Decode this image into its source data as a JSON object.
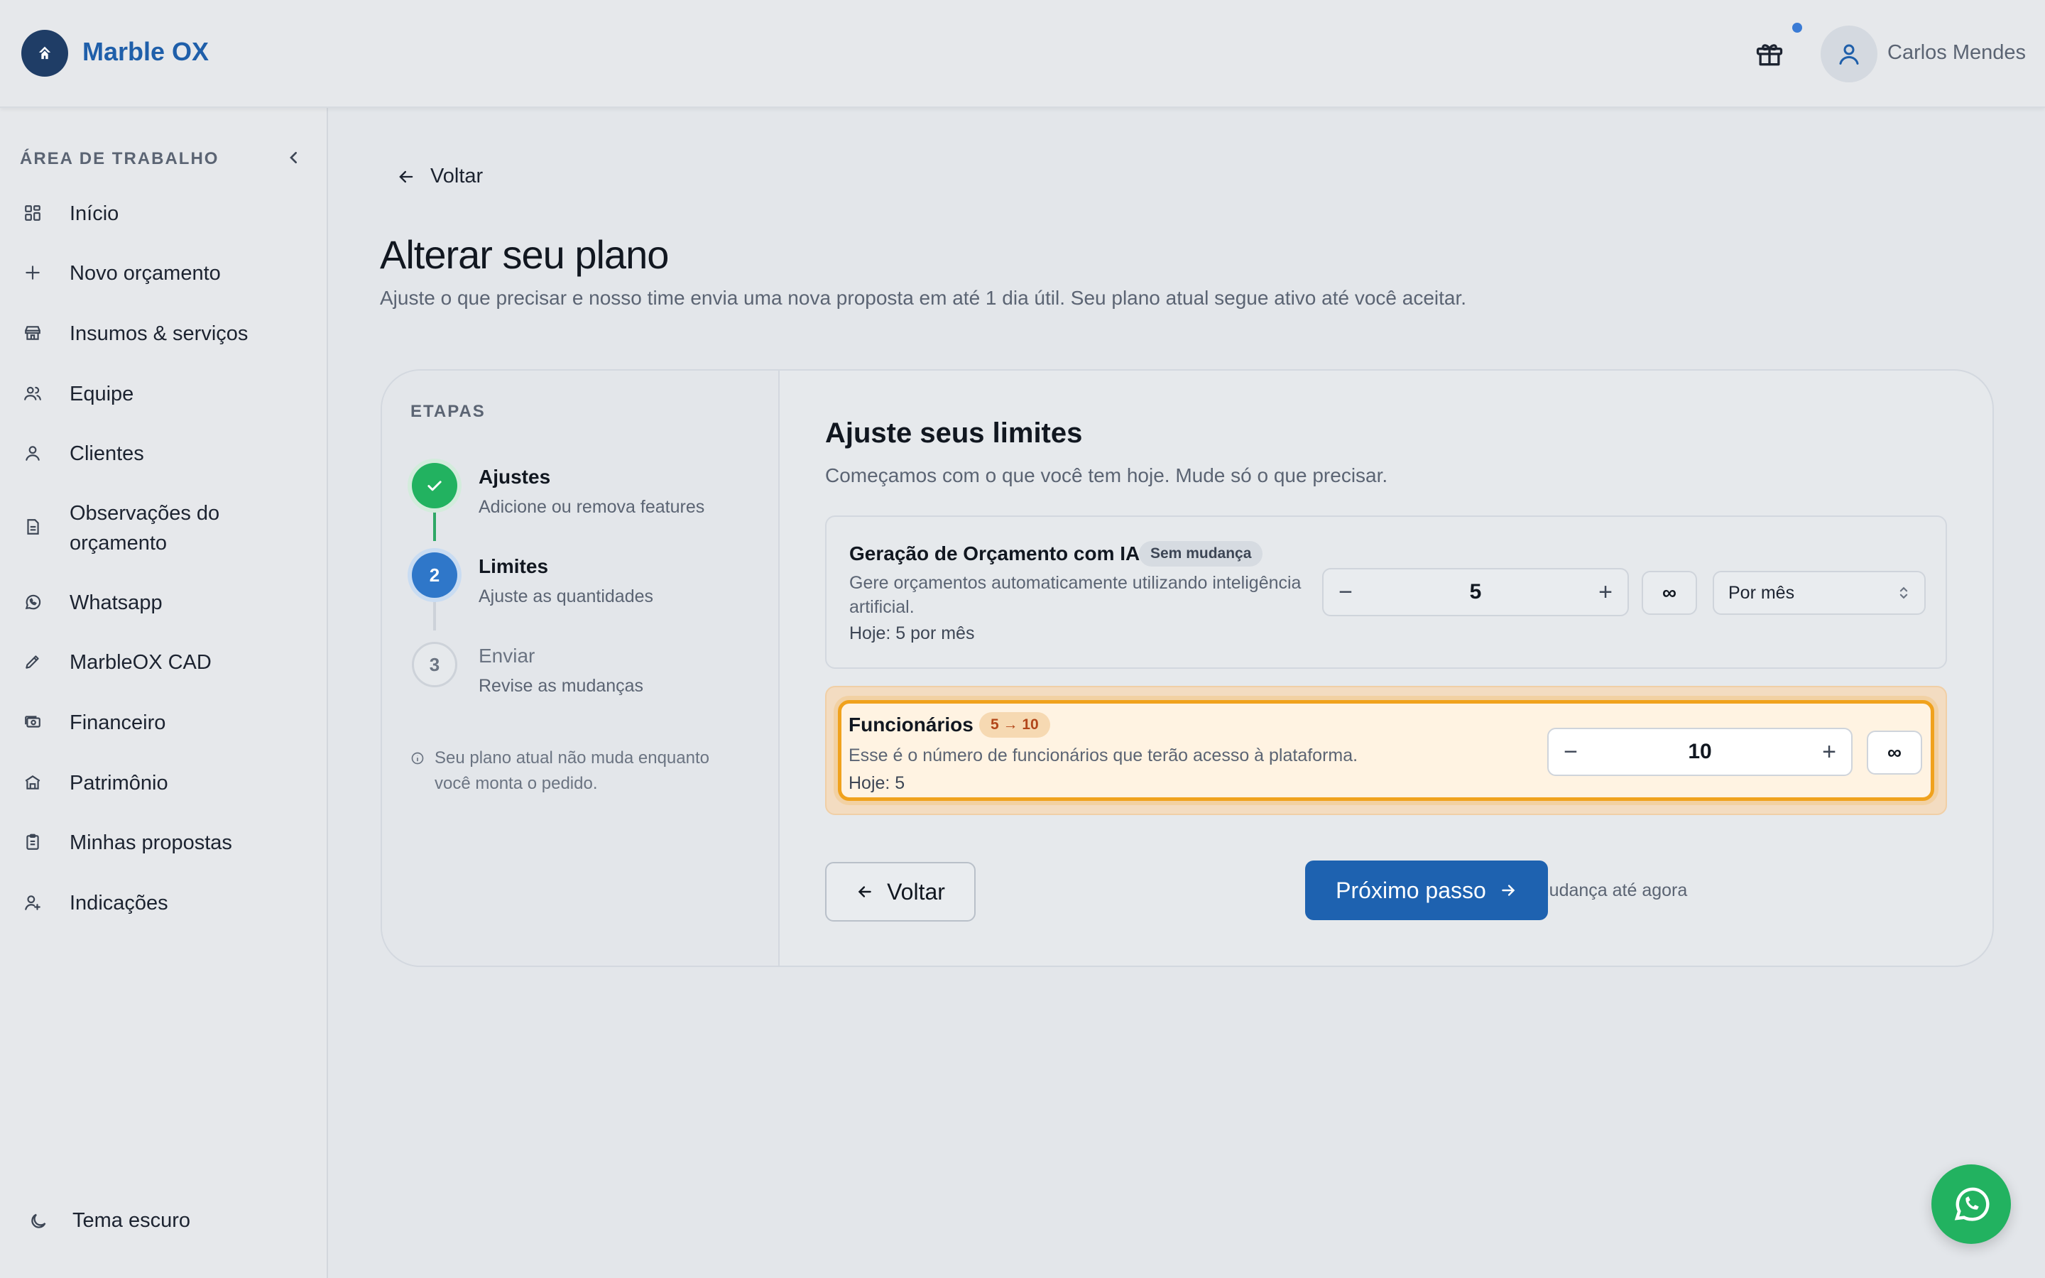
{
  "app": {
    "brand": "Marble OX"
  },
  "header": {
    "user_name": "Carlos Mendes"
  },
  "sidebar": {
    "section_title": "ÁREA DE TRABALHO",
    "items": [
      {
        "label": "Início",
        "icon": "grid-icon"
      },
      {
        "label": "Novo orçamento",
        "icon": "plus-icon"
      },
      {
        "label": "Insumos & serviços",
        "icon": "store-icon"
      },
      {
        "label": "Equipe",
        "icon": "users-icon"
      },
      {
        "label": "Clientes",
        "icon": "user-icon"
      },
      {
        "label": "Observações do",
        "label2": "orçamento",
        "icon": "document-icon"
      },
      {
        "label": "Whatsapp",
        "icon": "whatsapp-icon"
      },
      {
        "label": "MarbleOX CAD",
        "icon": "pencil-icon"
      },
      {
        "label": "Financeiro",
        "icon": "money-icon"
      },
      {
        "label": "Patrimônio",
        "icon": "building-icon"
      },
      {
        "label": "Minhas propostas",
        "icon": "clipboard-icon"
      },
      {
        "label": "Indicações",
        "icon": "user-plus-icon"
      }
    ],
    "theme_label": "Tema escuro"
  },
  "page": {
    "back_label": "Voltar",
    "title": "Alterar seu plano",
    "subtitle": "Ajuste o que precisar e nosso time envia uma nova proposta em até 1 dia útil. Seu plano atual segue ativo até você aceitar."
  },
  "steps": {
    "title": "ETAPAS",
    "items": [
      {
        "number": "1",
        "name": "Ajustes",
        "desc": "Adicione ou remova features",
        "state": "done"
      },
      {
        "number": "2",
        "name": "Limites",
        "desc": "Ajuste as quantidades",
        "state": "active"
      },
      {
        "number": "3",
        "name": "Enviar",
        "desc": "Revise as mudanças",
        "state": "todo"
      }
    ],
    "note_line1": "Seu plano atual não muda enquanto",
    "note_line2": "você monta o pedido."
  },
  "limits": {
    "title": "Ajuste seus limites",
    "subtitle": "Começamos com o que você tem hoje. Mude só o que precisar.",
    "rows": [
      {
        "name": "Geração de Orçamento com IA",
        "badge": "Sem mudança",
        "desc_line1": "Gere orçamentos automaticamente utilizando inteligência",
        "desc_line2": "artificial.",
        "today": "Hoje: 5 por mês",
        "value": "5",
        "infinite": "∞",
        "period": "Por mês"
      },
      {
        "name": "Funcionários",
        "badge": "5 → 10",
        "desc": "Esse é o número de funcionários que terão acesso à plataforma.",
        "today": "Hoje: 5",
        "value": "10",
        "infinite": "∞"
      }
    ]
  },
  "footer": {
    "back_label": "Voltar",
    "changes": "1 mudança até agora",
    "next_label": "Próximo passo"
  },
  "colors": {
    "primary": "#1e62b0",
    "success": "#22b260",
    "highlight": "#f0a21d"
  }
}
